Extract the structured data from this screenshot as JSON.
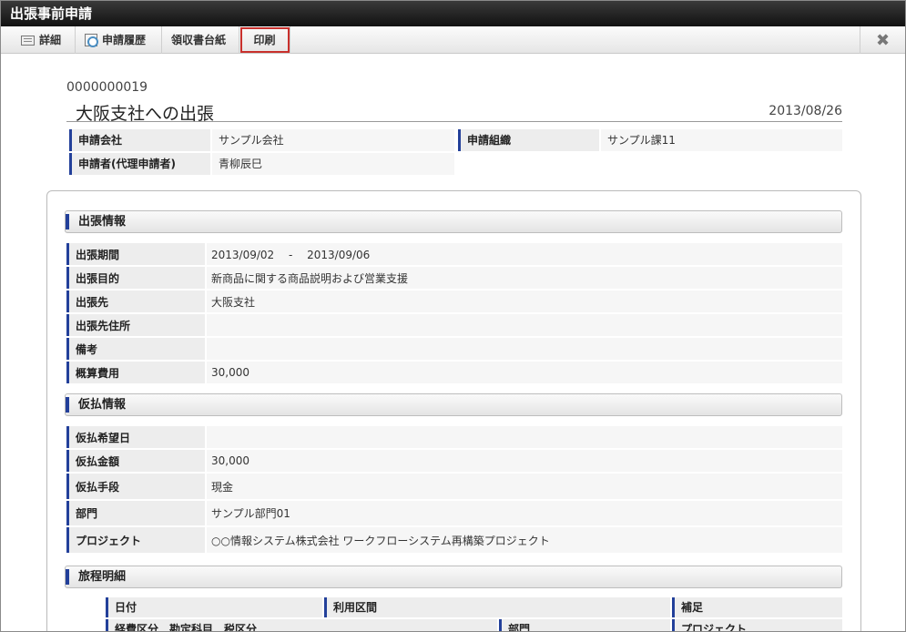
{
  "window": {
    "title": "出張事前申請"
  },
  "toolbar": {
    "detail_label": "詳細",
    "history_label": "申請履歴",
    "receipt_label": "領収書台紙",
    "print_label": "印刷",
    "close_icon": "close-icon"
  },
  "header": {
    "application_no": "0000000019",
    "subject": "大阪支社への出張",
    "date": "2013/08/26"
  },
  "applicant": {
    "company_label": "申請会社",
    "company_value": "サンプル会社",
    "org_label": "申請組織",
    "org_value": "サンプル課11",
    "person_label": "申請者(代理申請者)",
    "person_value": "青柳辰巳"
  },
  "trip": {
    "title": "出張情報",
    "rows": [
      {
        "label": "出張期間",
        "value": "2013/09/02　 -　 2013/09/06"
      },
      {
        "label": "出張目的",
        "value": "新商品に関する商品説明および営業支援"
      },
      {
        "label": "出張先",
        "value": "大阪支社"
      },
      {
        "label": "出張先住所",
        "value": ""
      },
      {
        "label": "備考",
        "value": ""
      },
      {
        "label": "概算費用",
        "value": "30,000"
      }
    ]
  },
  "advance": {
    "title": "仮払情報",
    "rows": [
      {
        "label": "仮払希望日",
        "value": ""
      },
      {
        "label": "仮払金額",
        "value": "30,000"
      },
      {
        "label": "仮払手段",
        "value": "現金"
      },
      {
        "label": "部門",
        "value": "サンプル部門01"
      },
      {
        "label": "プロジェクト",
        "value": "○○情報システム株式会社 ワークフローシステム再構築プロジェクト"
      }
    ]
  },
  "itinerary": {
    "title": "旅程明細",
    "col_date": "日付",
    "col_route": "利用区間",
    "col_note": "補足",
    "col_expense": "経費区分　勘定科目　税区分",
    "col_dept": "部門",
    "col_project": "プロジェクト"
  }
}
